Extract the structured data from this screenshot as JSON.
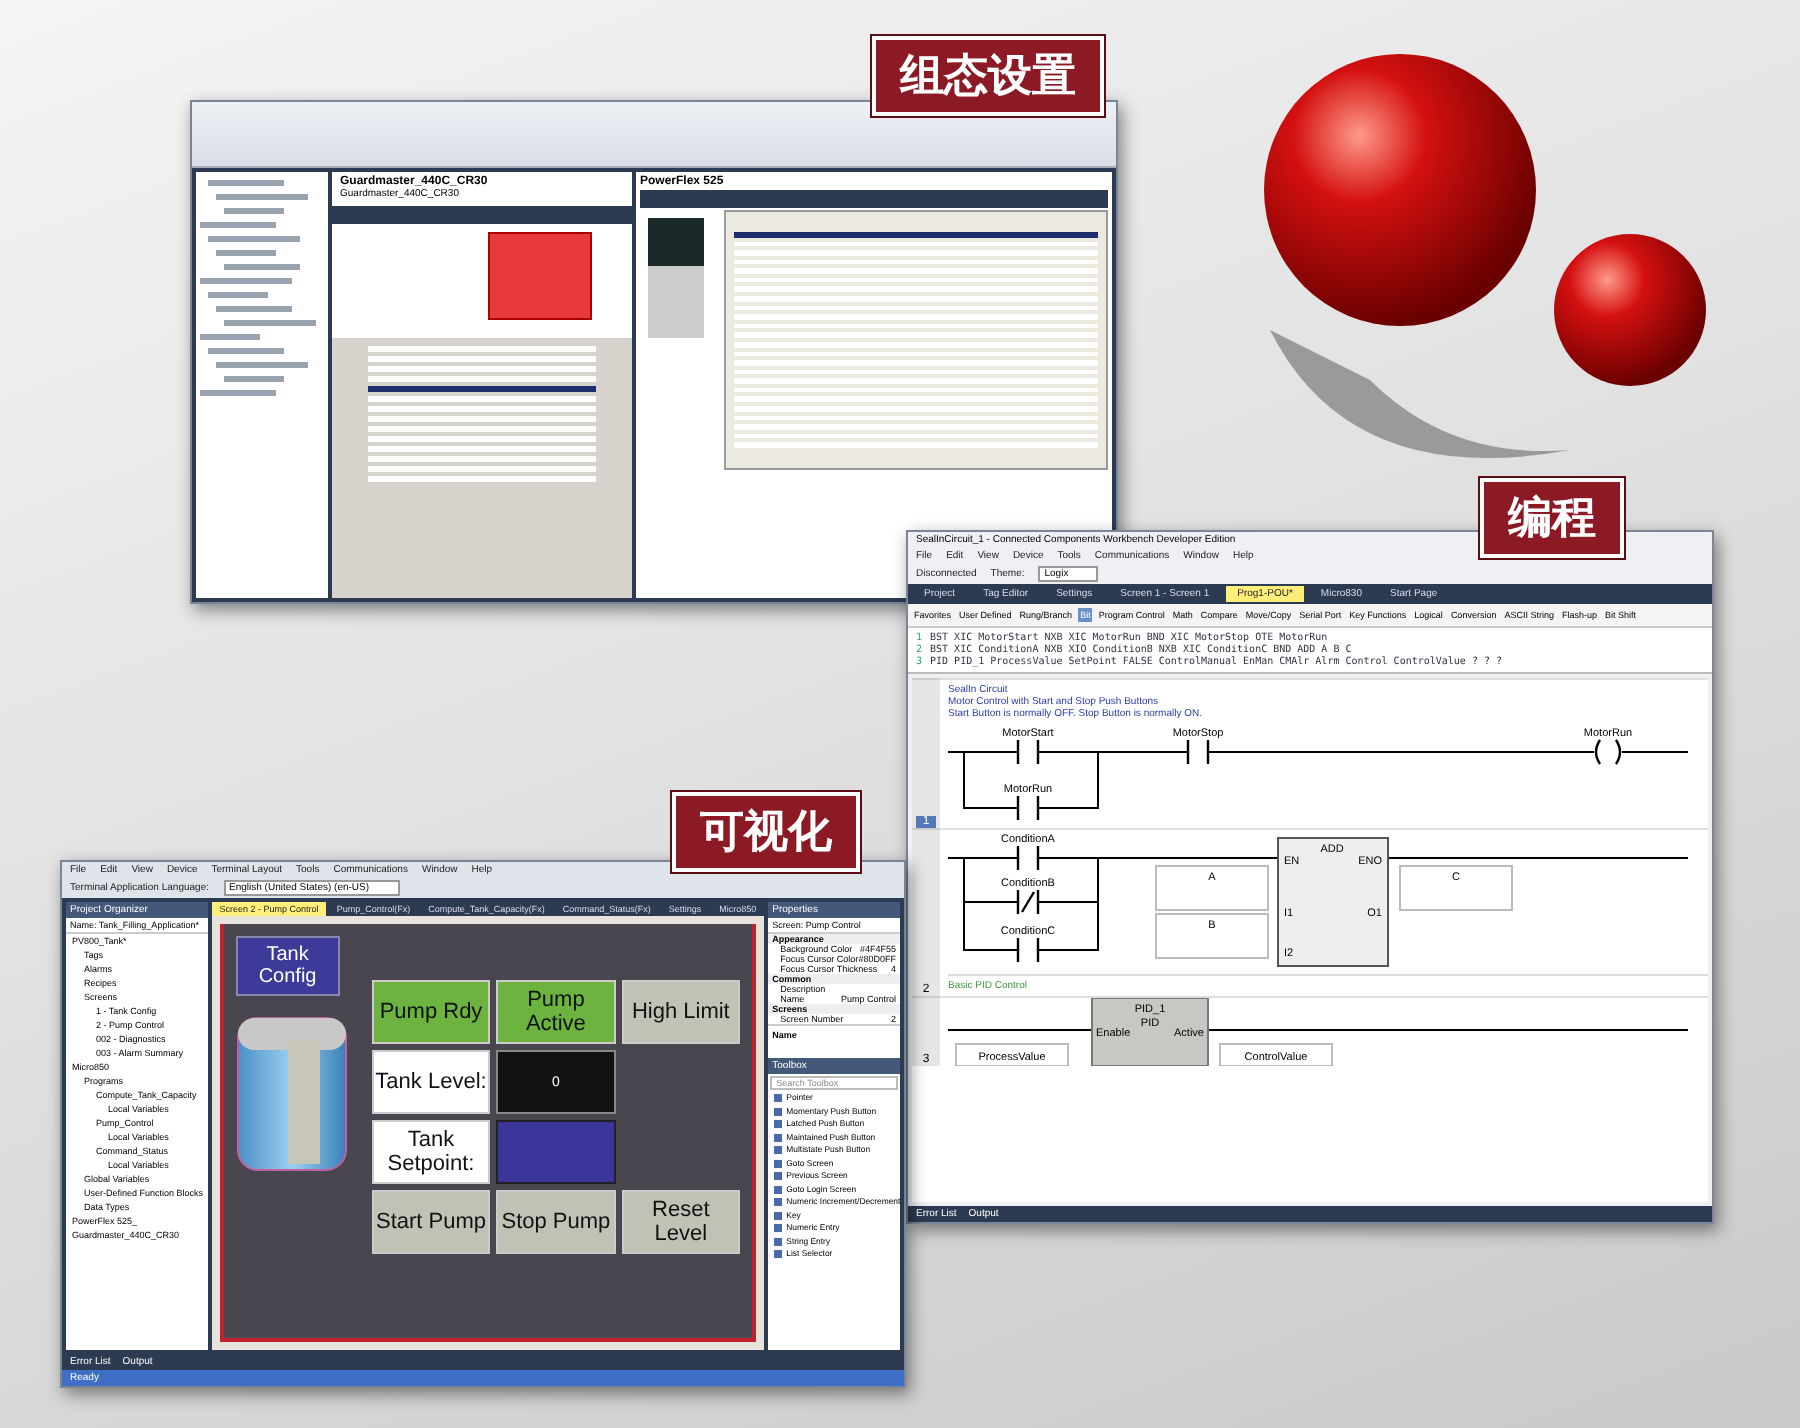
{
  "banners": [
    {
      "text": "组态设置"
    },
    {
      "text": "编程"
    },
    {
      "text": "可视化"
    }
  ],
  "configuration": {
    "device_title": "Guardmaster_440C_CR30",
    "device_subtitle": "Guardmaster_440C_CR30",
    "drive_title": "PowerFlex 525"
  },
  "programming": {
    "title": "SealInCircuit_1 - Connected Components Workbench Developer Edition",
    "menu": [
      "File",
      "Edit",
      "View",
      "Device",
      "Tools",
      "Communications",
      "Window",
      "Help"
    ],
    "connection": "Disconnected",
    "theme_label": "Theme:",
    "theme_value": "Logix",
    "tabs": [
      {
        "label": "Project",
        "selected": false
      },
      {
        "label": "Tag Editor",
        "selected": false
      },
      {
        "label": "Settings",
        "selected": false
      },
      {
        "label": "Screen 1 - Screen 1",
        "selected": false
      },
      {
        "label": "Prog1-POU*",
        "selected": true
      },
      {
        "label": "Micro830",
        "selected": false
      },
      {
        "label": "Start Page",
        "selected": false
      }
    ],
    "instruction_tabs": [
      {
        "label": "Favorites",
        "selected": false
      },
      {
        "label": "User Defined",
        "selected": false
      },
      {
        "label": "Rung/Branch",
        "selected": false
      },
      {
        "label": "Bit",
        "selected": true
      },
      {
        "label": "Program Control",
        "selected": false
      },
      {
        "label": "Math",
        "selected": false
      },
      {
        "label": "Compare",
        "selected": false
      },
      {
        "label": "Move/Copy",
        "selected": false
      },
      {
        "label": "Serial Port",
        "selected": false
      },
      {
        "label": "Key Functions",
        "selected": false
      },
      {
        "label": "Logical",
        "selected": false
      },
      {
        "label": "Conversion",
        "selected": false
      },
      {
        "label": "ASCII String",
        "selected": false
      },
      {
        "label": "Flash-up",
        "selected": false
      },
      {
        "label": "Bit Shift",
        "selected": false
      }
    ],
    "text_lines": [
      {
        "number": "1",
        "text": "BST XIC MotorStart NXB XIC MotorRun BND XIC MotorStop OTE MotorRun"
      },
      {
        "number": "2",
        "text": "BST XIC ConditionA NXB XIO ConditionB NXB XIC ConditionC BND ADD A B C"
      },
      {
        "number": "3",
        "text": "PID PID_1 ProcessValue SetPoint FALSE ControlManual EnMan CMAlr Alrm Control ControlValue ? ? ?"
      }
    ],
    "comments": [
      "SealIn Circuit",
      "Motor Control with Start and Stop Push Buttons",
      "Start Button is normally OFF.  Stop Button is normally ON."
    ],
    "rung_1": {
      "number": "1",
      "contacts": [
        {
          "label": "MotorStart",
          "kind": "no"
        },
        {
          "label": "MotorRun",
          "kind": "no"
        },
        {
          "label": "MotorStop",
          "kind": "no"
        }
      ],
      "coil": "MotorRun"
    },
    "rung_2": {
      "number": "2",
      "contacts": [
        {
          "label": "ConditionA",
          "kind": "no"
        },
        {
          "label": "ConditionB",
          "kind": "nc"
        },
        {
          "label": "ConditionC",
          "kind": "no"
        }
      ],
      "block": "ADD",
      "pins": [
        "EN",
        "ENO",
        "I1",
        "O1",
        "I2"
      ],
      "inputs": [
        "A",
        "B"
      ],
      "output": "C"
    },
    "pid_comment": "Basic PID Control",
    "rung_3": {
      "number": "3",
      "block": "PID_1",
      "pins": [
        "Enable",
        "PID",
        "Active"
      ],
      "input": "ProcessValue",
      "output": "ControlValue"
    },
    "status": [
      "Error List",
      "Output"
    ]
  },
  "visualization": {
    "menu": [
      "File",
      "Edit",
      "View",
      "Device",
      "Terminal Layout",
      "Tools",
      "Communications",
      "Window",
      "Help"
    ],
    "language_label": "Terminal Application Language:",
    "language_value": "English (United States) (en-US)",
    "organizer_title": "Project Organizer",
    "organizer_name": "Name:  Tank_Filling_Application*",
    "tree": [
      {
        "label": "PV800_Tank*",
        "children": [
          {
            "label": "Tags"
          },
          {
            "label": "Alarms"
          },
          {
            "label": "Recipes"
          },
          {
            "label": "Screens",
            "children": [
              {
                "label": "1 - Tank Config"
              },
              {
                "label": "2 - Pump Control"
              },
              {
                "label": "002 - Diagnostics"
              },
              {
                "label": "003 - Alarm Summary"
              }
            ]
          }
        ]
      },
      {
        "label": "Micro850",
        "children": [
          {
            "label": "Programs",
            "children": [
              {
                "label": "Compute_Tank_Capacity",
                "children": [
                  {
                    "label": "Local Variables"
                  }
                ]
              },
              {
                "label": "Pump_Control",
                "children": [
                  {
                    "label": "Local Variables"
                  }
                ]
              },
              {
                "label": "Command_Status",
                "children": [
                  {
                    "label": "Local Variables"
                  }
                ]
              }
            ]
          },
          {
            "label": "Global Variables"
          },
          {
            "label": "User-Defined Function Blocks"
          },
          {
            "label": "Data Types"
          }
        ]
      },
      {
        "label": "PowerFlex 525_"
      },
      {
        "label": "Guardmaster_440C_CR30"
      }
    ],
    "tabs": [
      {
        "label": "Screen 2 - Pump Control",
        "selected": true
      },
      {
        "label": "Pump_Control(Fx)",
        "selected": false
      },
      {
        "label": "Compute_Tank_Capacity(Fx)",
        "selected": false
      },
      {
        "label": "Command_Status(Fx)",
        "selected": false
      },
      {
        "label": "Settings",
        "selected": false
      },
      {
        "label": "Micro850",
        "selected": false
      }
    ],
    "config_button": "Tank Config",
    "indicators": [
      {
        "label": "Pump Rdy",
        "color": "#6cb33f"
      },
      {
        "label": "Pump Active",
        "color": "#6cb33f"
      },
      {
        "label": "High Limit",
        "color": "#c2c1b6"
      }
    ],
    "level_label": "Tank Level:",
    "level_value": "0",
    "setpoint_label": "Tank Setpoint:",
    "buttons": [
      "Start Pump",
      "Stop Pump",
      "Reset Level"
    ],
    "properties_title": "Properties",
    "properties_object": "Screen: Pump Control",
    "properties": [
      {
        "kind": "group",
        "label": "Appearance"
      },
      {
        "kind": "row",
        "label": "Background Color",
        "value": "#4F4F55"
      },
      {
        "kind": "row",
        "label": "Focus Cursor Color",
        "value": "#80D0FF"
      },
      {
        "kind": "row",
        "label": "Focus Cursor Thickness",
        "value": "4"
      },
      {
        "kind": "group",
        "label": "Common"
      },
      {
        "kind": "row",
        "label": "Description"
      },
      {
        "kind": "row",
        "label": "Name",
        "value": "Pump Control"
      },
      {
        "kind": "group",
        "label": "Screens"
      },
      {
        "kind": "row",
        "label": "Screen Number",
        "value": "2"
      }
    ],
    "properties_footer": "Name",
    "toolbox_title": "Toolbox",
    "toolbox_search": "Search Toolbox",
    "toolbox_items": [
      "Pointer",
      "Momentary Push Button",
      "Latched Push Button",
      "Maintained Push Button",
      "Multistate Push Button",
      "Goto Screen",
      "Previous Screen",
      "Goto Login Screen",
      "Numeric Increment/Decrement",
      "Key",
      "Numeric Entry",
      "String Entry",
      "List Selector"
    ],
    "status": [
      "Error List",
      "Output"
    ],
    "ready": "Ready"
  }
}
